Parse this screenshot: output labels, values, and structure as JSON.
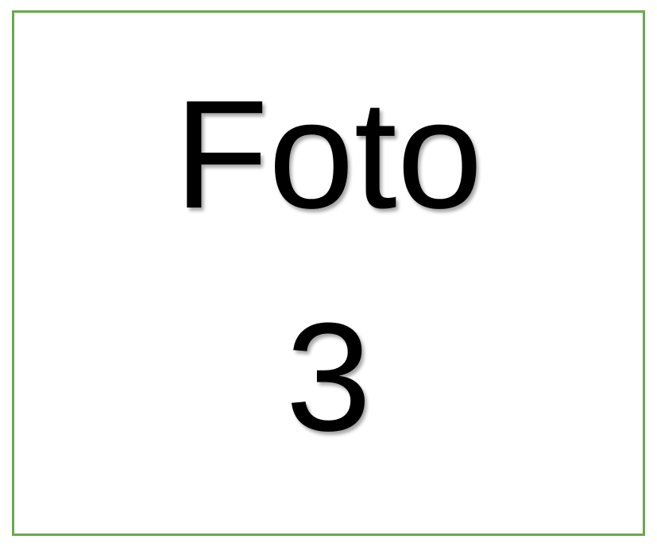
{
  "placeholder": {
    "line1": "Foto",
    "line2": "3",
    "border_color": "#6aa84f",
    "text_color": "#000000",
    "background_color": "#ffffff"
  }
}
